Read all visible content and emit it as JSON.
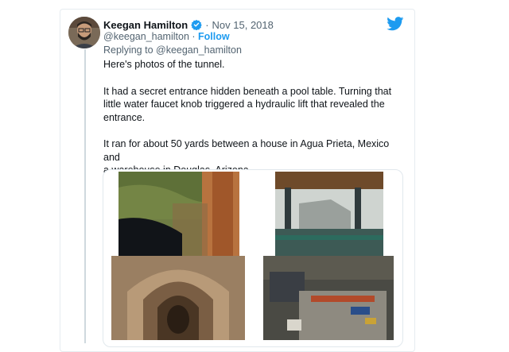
{
  "tweet": {
    "author_name": "Keegan Hamilton",
    "separator": "·",
    "date": "Nov 15, 2018",
    "handle": "@keegan_hamilton",
    "handle_separator": " · ",
    "follow_label": "Follow",
    "replying_prefix": "Replying to ",
    "replying_to": "@keegan_hamilton",
    "paragraphs": [
      "Here's photos of the tunnel.",
      "It had a secret entrance hidden beneath a pool table. Turning that\nlittle water faucet knob triggered a hydraulic lift that revealed the\nentrance.",
      "It ran for about 50 yards between a house in Agua Prieta, Mexico and\na warehouse in Douglas, Arizona."
    ]
  },
  "icons": {
    "verified": "verified-badge-icon",
    "platform": "twitter-bird-icon"
  },
  "colors": {
    "link_blue": "#1d9bf0",
    "text": "#0f1419",
    "muted": "#536471",
    "border": "#e6ecf0"
  }
}
